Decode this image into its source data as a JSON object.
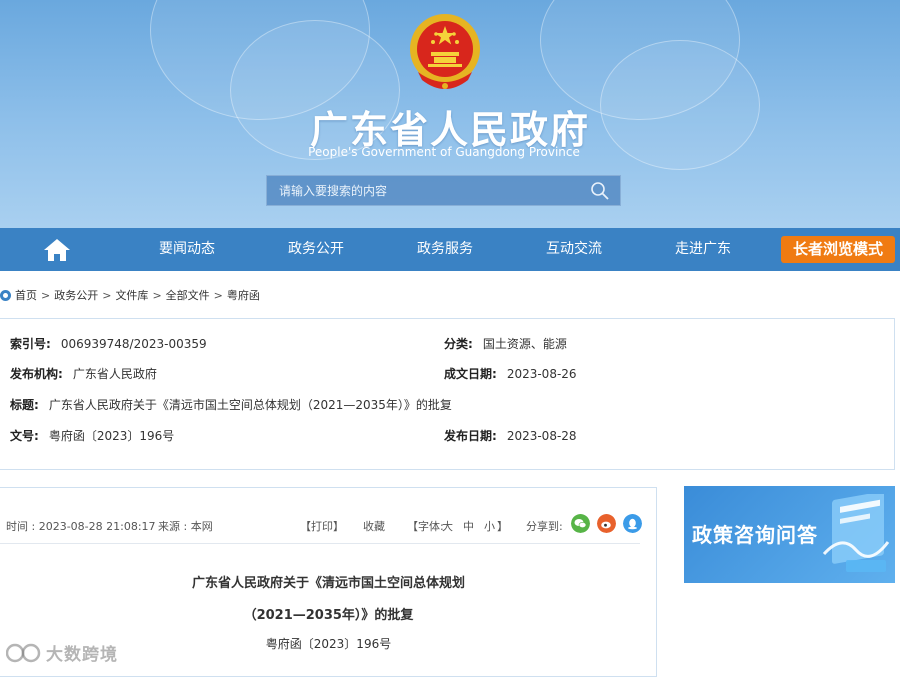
{
  "header": {
    "title": "广东省人民政府",
    "subtitle": "People's Government of Guangdong Province",
    "search_placeholder": "请输入要搜索的内容",
    "brand_color": "#3a82c4"
  },
  "nav": {
    "home_icon": "home-icon",
    "items": [
      "要闻动态",
      "政务公开",
      "政务服务",
      "互动交流",
      "走进广东"
    ],
    "elder_mode": "长者浏览模式"
  },
  "breadcrumb": [
    "首页",
    "政务公开",
    "文件库",
    "全部文件",
    "粤府函"
  ],
  "meta": {
    "index_label": "索引号:",
    "index_value": "006939748/2023-00359",
    "category_label": "分类:",
    "category_value": "国土资源、能源",
    "publisher_label": "发布机构:",
    "publisher_value": "广东省人民政府",
    "created_label": "成文日期:",
    "created_value": "2023-08-26",
    "title_label": "标题:",
    "title_value": "广东省人民政府关于《清远市国土空间总体规划（2021—2035年）》的批复",
    "docno_label": "文号:",
    "docno_value": "粤府函〔2023〕196号",
    "pubdate_label": "发布日期:",
    "pubdate_value": "2023-08-28"
  },
  "article": {
    "time": "时间 : 2023-08-28 21:08:17",
    "source": "来源 : 本网",
    "print": "【打印】",
    "favorite": "收藏",
    "font_label": "【字体:",
    "font_large": "大",
    "font_medium": "中",
    "font_small": "小",
    "font_close": "】",
    "share_label": "分享到:",
    "title_line1": "广东省人民政府关于《清远市国土空间总体规划",
    "title_line2": "（2021—2035年）》的批复",
    "doc_number": "粤府函〔2023〕196号"
  },
  "side": {
    "consult_text": "政策咨询问答"
  },
  "watermark": {
    "text": "大数跨境"
  }
}
